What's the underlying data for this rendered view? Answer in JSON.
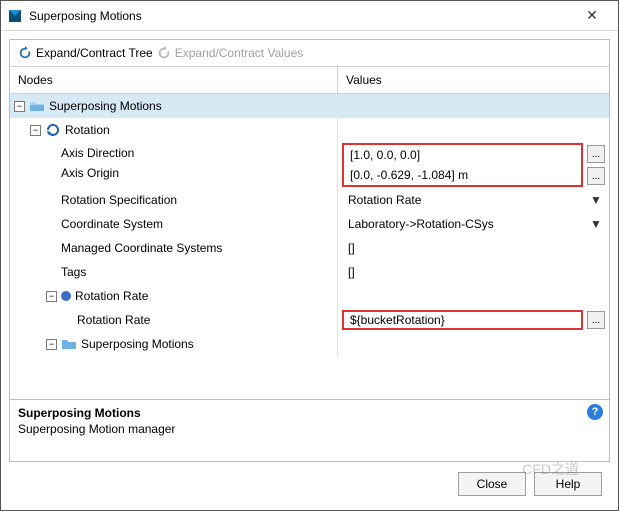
{
  "window": {
    "title": "Superposing Motions"
  },
  "toolbar": {
    "expand_tree": "Expand/Contract Tree",
    "expand_values": "Expand/Contract Values"
  },
  "headers": {
    "nodes": "Nodes",
    "values": "Values"
  },
  "tree": {
    "root_label": "Superposing Motions",
    "rotation_label": "Rotation",
    "axis_direction_label": "Axis Direction",
    "axis_direction_value": "[1.0, 0.0, 0.0]",
    "axis_origin_label": "Axis Origin",
    "axis_origin_value": "[0.0, -0.629, -1.084] m",
    "rotation_spec_label": "Rotation Specification",
    "rotation_spec_value": "Rotation Rate",
    "coord_sys_label": "Coordinate System",
    "coord_sys_value": "Laboratory->Rotation-CSys",
    "managed_cs_label": "Managed Coordinate Systems",
    "managed_cs_value": "[]",
    "tags_label": "Tags",
    "tags_value": "[]",
    "rotation_rate_node_label": "Rotation Rate",
    "rotation_rate_label": "Rotation Rate",
    "rotation_rate_value": "${bucketRotation}",
    "child_superposing_label": "Superposing Motions"
  },
  "description": {
    "title": "Superposing Motions",
    "body": "Superposing Motion manager"
  },
  "buttons": {
    "close": "Close",
    "help": "Help"
  },
  "watermark": "CFD之道",
  "ellipsis": "..."
}
